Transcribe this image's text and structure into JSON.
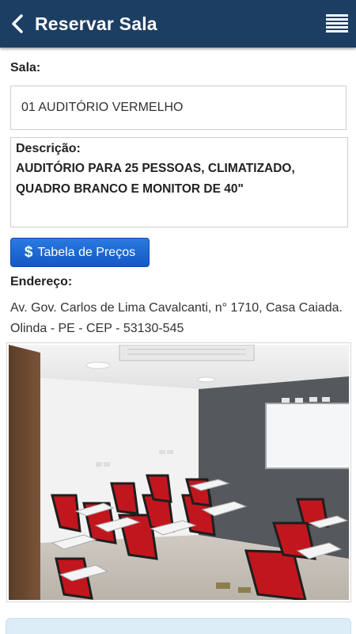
{
  "app_bar": {
    "title": "Reservar Sala",
    "back_icon": "chevron-left-icon",
    "menu_icon": "hamburger-menu-icon",
    "background_color": "#1c3e63"
  },
  "room": {
    "label": "Sala:",
    "value": "01 AUDITÓRIO VERMELHO"
  },
  "description": {
    "label": "Descrição:",
    "line1": "AUDITÓRIO PARA 25 PESSOAS, CLIMATIZADO,",
    "line2": "QUADRO BRANCO E MONITOR DE 40\""
  },
  "price_button": {
    "icon": "dollar-icon",
    "icon_glyph": "$",
    "label": "Tabela de Preços",
    "color": "#1f6bd6"
  },
  "address": {
    "label": "Endereço:",
    "line1": "Av. Gov. Carlos de Lima Cavalcanti, n° 1710, Casa Caiada.",
    "line2": "Olinda - PE - CEP - 53130-545"
  },
  "photo": {
    "subject": "room-photo"
  },
  "info_panel": {
    "color": "#dcedf7"
  }
}
